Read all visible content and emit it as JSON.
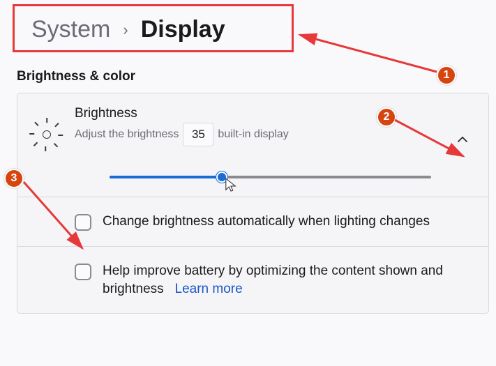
{
  "breadcrumb": {
    "parent": "System",
    "separator": "›",
    "current": "Display"
  },
  "section": {
    "title": "Brightness & color"
  },
  "brightness": {
    "title": "Brightness",
    "desc_prefix": "Adjust the brightness",
    "value": "35",
    "desc_suffix": "built-in display",
    "slider_percent": 35
  },
  "option_auto": {
    "label": "Change brightness automatically when lighting changes",
    "checked": false
  },
  "option_battery": {
    "label": "Help improve battery by optimizing the content shown and brightness",
    "link": "Learn more",
    "checked": false
  },
  "annotations": {
    "n1": "1",
    "n2": "2",
    "n3": "3"
  },
  "colors": {
    "accent": "#1a6dd6",
    "annotation": "#d64510",
    "highlight_border": "#e63939"
  }
}
